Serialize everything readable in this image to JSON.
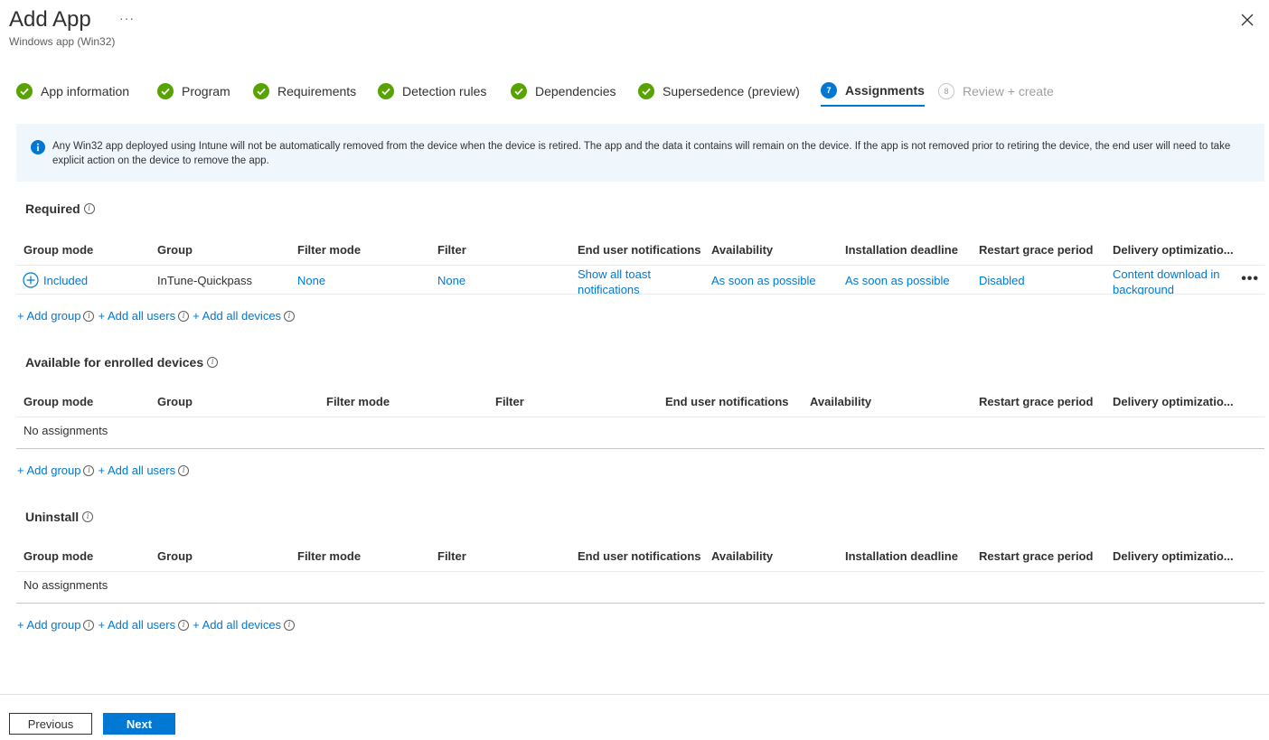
{
  "header": {
    "title": "Add App",
    "more": "···",
    "subtitle": "Windows app (Win32)"
  },
  "steps": [
    {
      "label": "App information",
      "state": "complete"
    },
    {
      "label": "Program",
      "state": "complete"
    },
    {
      "label": "Requirements",
      "state": "complete"
    },
    {
      "label": "Detection rules",
      "state": "complete"
    },
    {
      "label": "Dependencies",
      "state": "complete"
    },
    {
      "label": "Supersedence (preview)",
      "state": "complete"
    },
    {
      "label": "Assignments",
      "number": "7",
      "state": "current"
    },
    {
      "label": "Review + create",
      "number": "8",
      "state": "disabled"
    }
  ],
  "info_bar": {
    "text": "Any Win32 app deployed using Intune will not be automatically removed from the device when the device is retired. The app and the data it contains will remain on the device. If the app is not removed prior to retiring the device, the end user will need to take explicit action on the device to remove the app."
  },
  "required": {
    "title": "Required",
    "headers": [
      "Group mode",
      "Group",
      "Filter mode",
      "Filter",
      "End user notifications",
      "Availability",
      "Installation deadline",
      "Restart grace period",
      "Delivery optimizatio..."
    ],
    "row": {
      "group_mode": "Included",
      "group": "InTune-Quickpass",
      "filter_mode": "None",
      "filter": "None",
      "notifications": "Show all toast notifications",
      "availability": "As soon as possible",
      "deadline": "As soon as possible",
      "restart": "Disabled",
      "delivery": "Content download in background",
      "more": "•••"
    },
    "add_group": "+ Add group",
    "add_all_users": "+ Add all users",
    "add_all_devices": "+ Add all devices"
  },
  "available": {
    "title": "Available for enrolled devices",
    "headers": [
      "Group mode",
      "Group",
      "Filter mode",
      "Filter",
      "End user notifications",
      "Availability",
      "Restart grace period",
      "Delivery optimizatio..."
    ],
    "empty": "No assignments",
    "add_group": "+ Add group",
    "add_all_users": "+ Add all users"
  },
  "uninstall": {
    "title": "Uninstall",
    "headers": [
      "Group mode",
      "Group",
      "Filter mode",
      "Filter",
      "End user notifications",
      "Availability",
      "Installation deadline",
      "Restart grace period",
      "Delivery optimizatio..."
    ],
    "empty": "No assignments",
    "add_group": "+ Add group",
    "add_all_users": "+ Add all users",
    "add_all_devices": "+ Add all devices"
  },
  "footer": {
    "previous": "Previous",
    "next": "Next"
  },
  "info_glyph": "i",
  "colors": {
    "accent": "#0078d4",
    "success": "#57a300",
    "info_bg": "#eff6fc"
  }
}
